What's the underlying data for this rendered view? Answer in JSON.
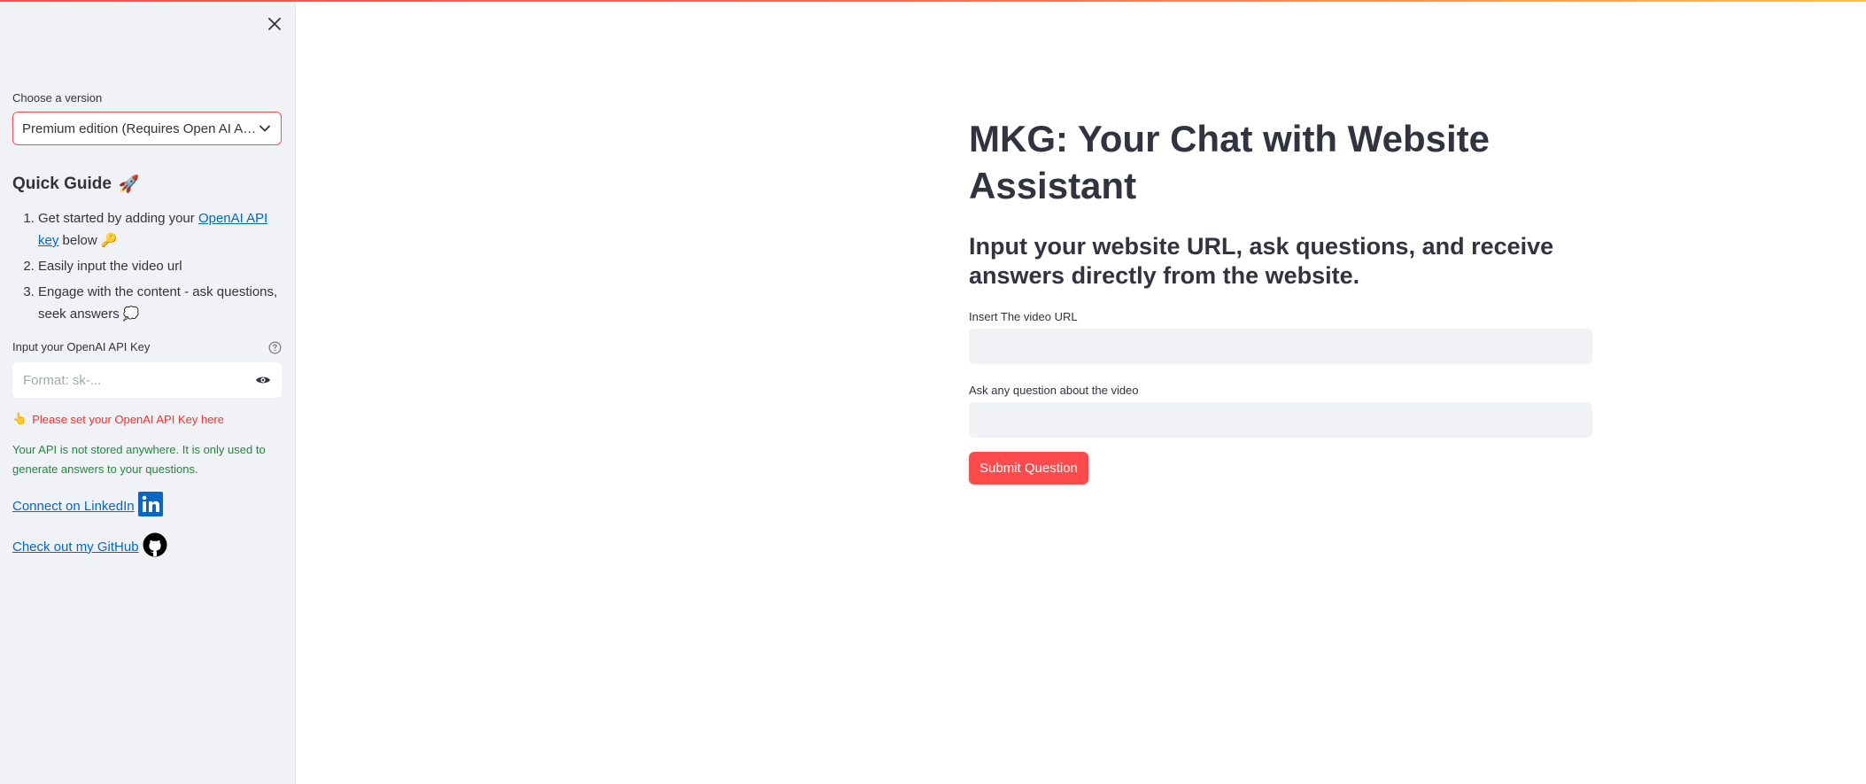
{
  "sidebar": {
    "version_label": "Choose a version",
    "version_selected": "Premium edition (Requires Open AI API Key)",
    "guide_title": "Quick Guide",
    "guide_emoji": "🚀",
    "steps": [
      {
        "prefix": "Get started by adding your ",
        "link": "OpenAI API key",
        "suffix": " below 🔑"
      },
      {
        "text": "Easily input the video url"
      },
      {
        "text": "Engage with the content - ask questions, seek answers 💭"
      }
    ],
    "api_label": "Input your OpenAI API Key",
    "api_placeholder": "Format: sk-...",
    "warning_emoji": "👆",
    "warning_text": "Please set your OpenAI API Key here",
    "info_text": "Your API is not stored anywhere. It is only used to generate answers to your questions.",
    "linkedin_text": "Connect on LinkedIn",
    "github_text": "Check out my GitHub"
  },
  "main": {
    "title": "MKG: Your Chat with Website Assistant",
    "subtitle": "Input your website URL, ask questions, and receive answers directly from the website.",
    "url_label": "Insert The video URL",
    "url_value": "",
    "question_label": "Ask any question about the video",
    "question_value": "",
    "submit_label": "Submit Question"
  },
  "colors": {
    "accent": "#ff4b4b",
    "link": "#0068c9",
    "success": "#21893d",
    "sidebar_bg": "#f0f2f6",
    "linkedin": "#0a66c2"
  }
}
